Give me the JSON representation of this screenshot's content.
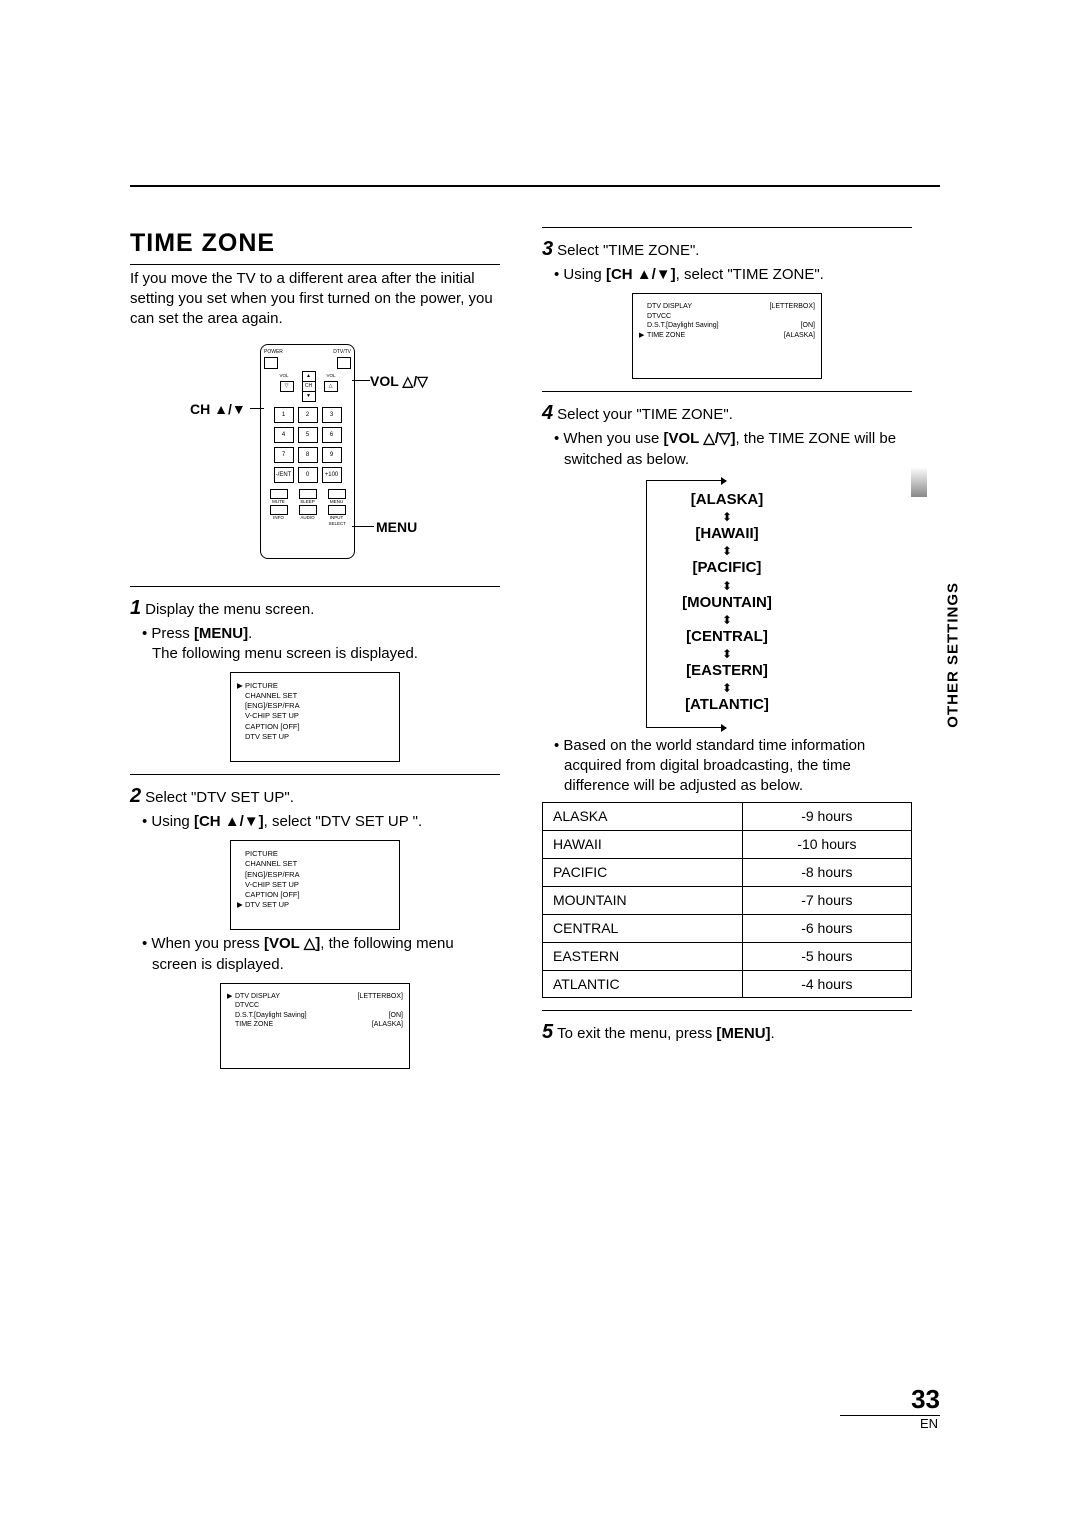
{
  "section_title": "TIME ZONE",
  "intro": "If you move the TV to a different area after the initial setting you set when you first turned on the power, you can set the area again.",
  "remote": {
    "label_vol": "VOL",
    "label_ch": "CH",
    "label_menu": "MENU",
    "top_labels": {
      "power": "POWER",
      "dtvtv": "DTV/TV"
    },
    "arrow_labels": {
      "vol_l": "VOL",
      "vol_r": "VOL",
      "ch": "CH",
      "tri_down": "▽",
      "tri_up": "△",
      "up": "▲",
      "down": "▼"
    },
    "numpad": [
      "1",
      "2",
      "3",
      "4",
      "5",
      "6",
      "7",
      "8",
      "9",
      "-/ENT",
      "0",
      "+100"
    ],
    "bottom_row1": [
      "MUTE",
      "SLEEP",
      "MENU"
    ],
    "bottom_row2": [
      "INFO",
      "AUDIO",
      "INPUT SELECT"
    ]
  },
  "step1": {
    "title": "Display the menu screen.",
    "bullet": "Press ",
    "bold": "[MENU]",
    "tail": ".",
    "sub": "The following menu screen is displayed.",
    "menu1": [
      {
        "sel": true,
        "name": "PICTURE"
      },
      {
        "sel": false,
        "name": "CHANNEL SET"
      },
      {
        "sel": false,
        "name": "[ENG]/ESP/FRA"
      },
      {
        "sel": false,
        "name": "V-CHIP SET UP"
      },
      {
        "sel": false,
        "name": "CAPTION [OFF]"
      },
      {
        "sel": false,
        "name": "DTV SET UP"
      }
    ]
  },
  "step2": {
    "title": "Select \"DTV SET UP\".",
    "bullet_pre": "Using ",
    "bullet_bold": "[CH ▲/▼]",
    "bullet_post": ", select \"DTV SET UP \".",
    "menu2": [
      {
        "sel": false,
        "name": "PICTURE"
      },
      {
        "sel": false,
        "name": "CHANNEL SET"
      },
      {
        "sel": false,
        "name": "[ENG]/ESP/FRA"
      },
      {
        "sel": false,
        "name": "V-CHIP SET UP"
      },
      {
        "sel": false,
        "name": "CAPTION [OFF]"
      },
      {
        "sel": true,
        "name": "DTV SET UP"
      }
    ],
    "press_pre": "When you press ",
    "press_bold": "[VOL △]",
    "press_post": ", the following menu screen is displayed.",
    "menu3": [
      {
        "sel": true,
        "name": "DTV DISPLAY",
        "val": "[LETTERBOX]"
      },
      {
        "sel": false,
        "name": "DTVCC",
        "val": ""
      },
      {
        "sel": false,
        "name": "D.S.T.[Daylight Saving]",
        "val": "[ON]"
      },
      {
        "sel": false,
        "name": "TIME ZONE",
        "val": "[ALASKA]"
      }
    ]
  },
  "step3": {
    "title": "Select \"TIME ZONE\".",
    "bullet_pre": "Using ",
    "bullet_bold": "[CH ▲/▼]",
    "bullet_post": ", select \"TIME ZONE\".",
    "menu4": [
      {
        "sel": false,
        "name": "DTV DISPLAY",
        "val": "[LETTERBOX]"
      },
      {
        "sel": false,
        "name": "DTVCC",
        "val": ""
      },
      {
        "sel": false,
        "name": "D.S.T.[Daylight Saving]",
        "val": "[ON]"
      },
      {
        "sel": true,
        "name": "TIME ZONE",
        "val": "[ALASKA]"
      }
    ]
  },
  "step4": {
    "title": "Select your \"TIME ZONE\".",
    "bullet_pre": "When you use ",
    "bullet_bold": "[VOL △/▽]",
    "bullet_post": ", the TIME ZONE will be switched as below.",
    "zones": [
      "[ALASKA]",
      "[HAWAII]",
      "[PACIFIC]",
      "[MOUNTAIN]",
      "[CENTRAL]",
      "[EASTERN]",
      "[ATLANTIC]"
    ],
    "note": "Based on the world standard time information acquired from digital broadcasting, the time difference will be adjusted as below.",
    "table": [
      {
        "zone": "ALASKA",
        "offset": "-9 hours"
      },
      {
        "zone": "HAWAII",
        "offset": "-10 hours"
      },
      {
        "zone": "PACIFIC",
        "offset": "-8 hours"
      },
      {
        "zone": "MOUNTAIN",
        "offset": "-7 hours"
      },
      {
        "zone": "CENTRAL",
        "offset": "-6 hours"
      },
      {
        "zone": "EASTERN",
        "offset": "-5 hours"
      },
      {
        "zone": "ATLANTIC",
        "offset": "-4 hours"
      }
    ]
  },
  "step5": {
    "pre": "To exit the menu, press ",
    "bold": "[MENU]",
    "post": "."
  },
  "side_label": "OTHER SETTINGS",
  "page_number": "33",
  "page_lang": "EN"
}
